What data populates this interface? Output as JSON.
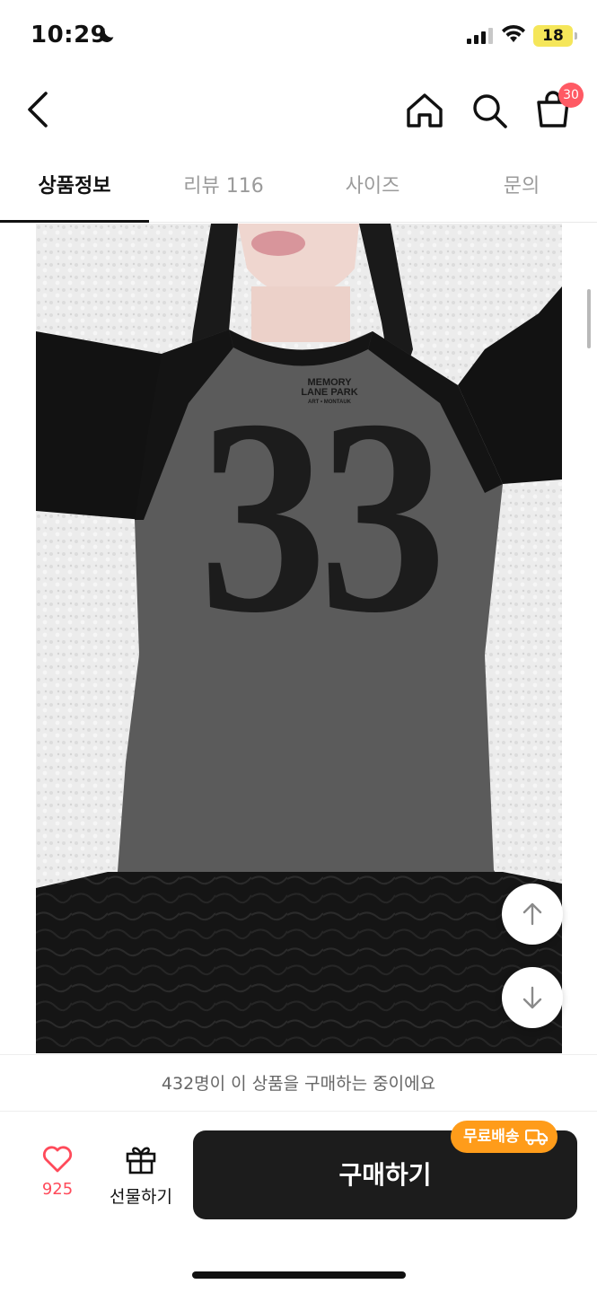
{
  "status_bar": {
    "time": "10:29",
    "battery": "18"
  },
  "nav": {
    "cart_count": "30"
  },
  "tabs": [
    {
      "label": "상품정보",
      "active": true
    },
    {
      "label": "리뷰 116",
      "active": false
    },
    {
      "label": "사이즈",
      "active": false
    },
    {
      "label": "문의",
      "active": false
    }
  ],
  "product": {
    "print_brand_line1": "MEMORY",
    "print_brand_line2": "LANE PARK",
    "print_brand_line3": "ART • MONTAUK",
    "print_number": "33"
  },
  "banner": {
    "buyers_text": "432명이 이 상품을 구매하는 중이에요"
  },
  "bottom_bar": {
    "like_count": "925",
    "gift_label": "선물하기",
    "buy_label": "구매하기",
    "free_shipping_label": "무료배송"
  },
  "colors": {
    "accent_red": "#ff4a5a",
    "badge_red": "#ff5a64",
    "buy_button": "#1c1c1c",
    "free_ship_orange": "#ff9c1a"
  }
}
